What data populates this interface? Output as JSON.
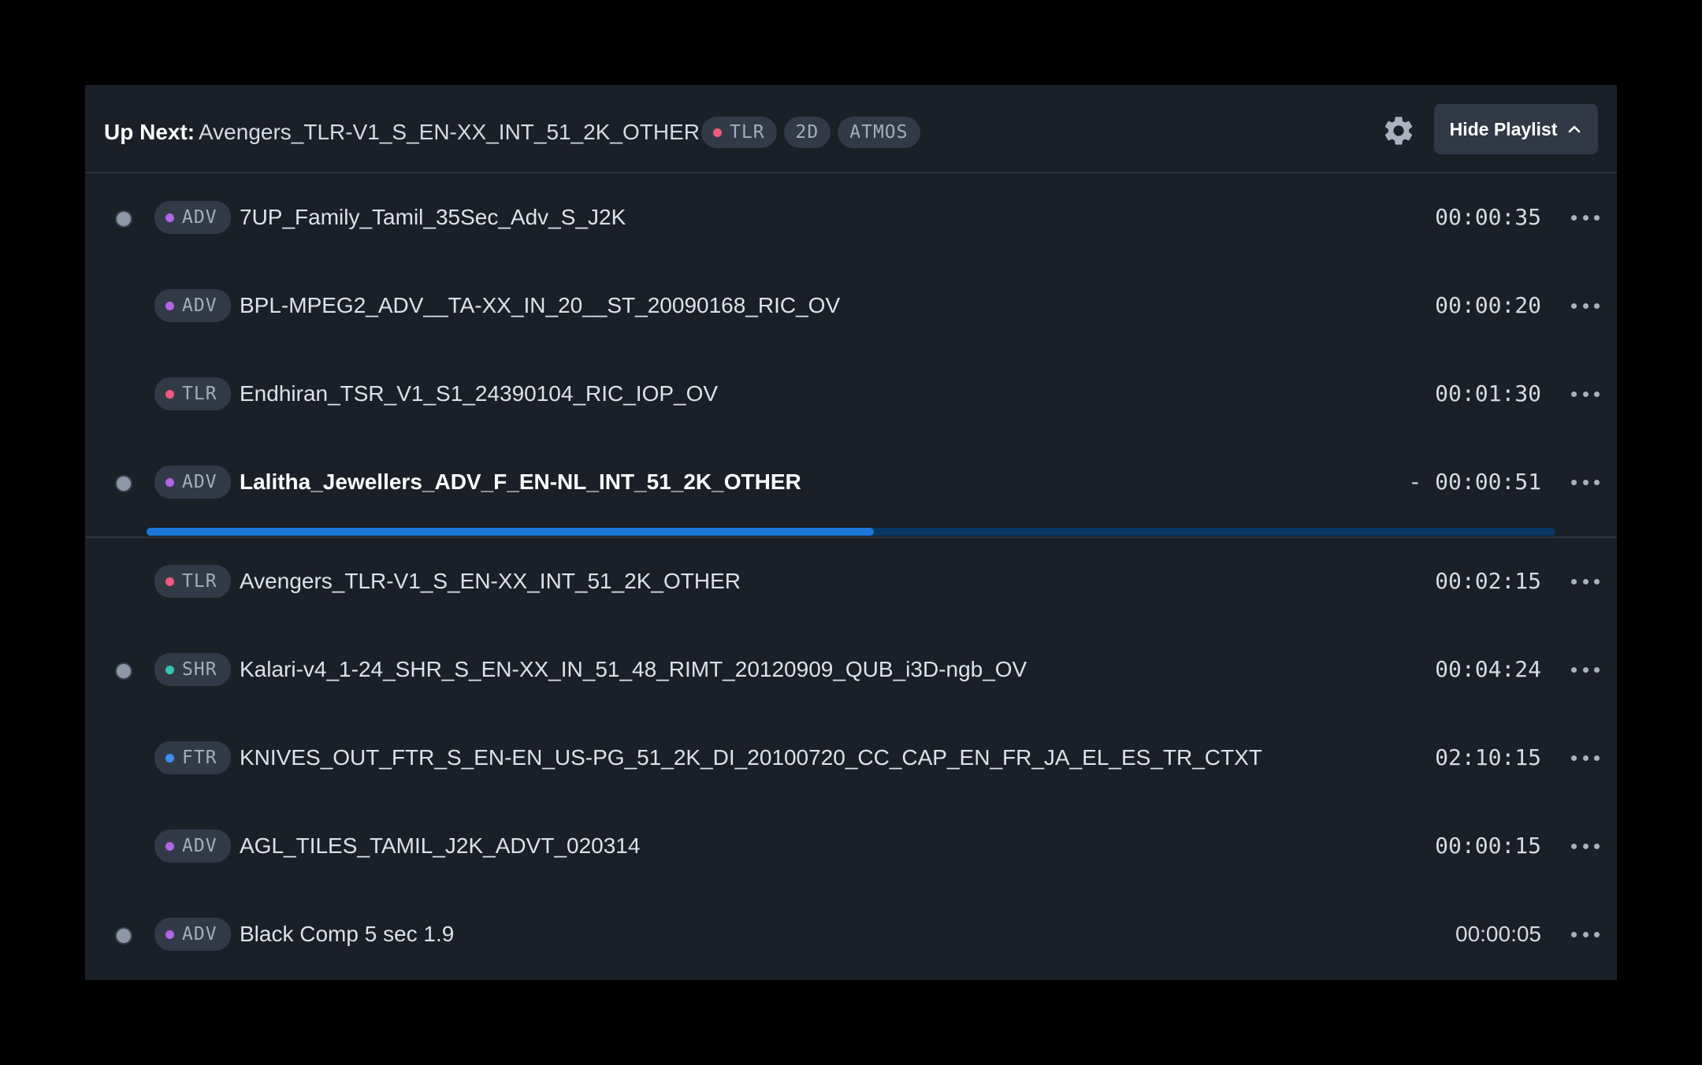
{
  "header": {
    "label": "Up Next:",
    "title": "Avengers_TLR-V1_S_EN-XX_INT_51_2K_OTHER",
    "badges": [
      {
        "text": "TLR",
        "dot_color": "#f15a80"
      },
      {
        "text": "2D"
      },
      {
        "text": "ATMOS"
      }
    ],
    "settings_icon": "gear-icon",
    "hide_button": {
      "label": "Hide Playlist",
      "icon": "chevron-up-icon"
    }
  },
  "colors": {
    "ADV": "#b264e6",
    "TLR": "#f15a80",
    "SHR": "#39c3b5",
    "FTR": "#3b8ff0",
    "progress_fill": "#1c78d8",
    "progress_track": "#0a3764"
  },
  "playlist": [
    {
      "type": "ADV",
      "name": "7UP_Family_Tamil_35Sec_Adv_S_J2K",
      "duration": "00:00:35",
      "marker": true
    },
    {
      "type": "ADV",
      "name": "BPL-MPEG2_ADV__TA-XX_IN_20__ST_20090168_RIC_OV",
      "duration": "00:00:20",
      "marker": false
    },
    {
      "type": "TLR",
      "name": "Endhiran_TSR_V1_S1_24390104_RIC_IOP_OV",
      "duration": "00:01:30",
      "marker": false
    },
    {
      "type": "ADV",
      "name": "Lalitha_Jewellers_ADV_F_EN-NL_INT_51_2K_OTHER",
      "duration": "- 00:00:51",
      "marker": true,
      "active": true
    },
    {
      "type": "TLR",
      "name": "Avengers_TLR-V1_S_EN-XX_INT_51_2K_OTHER",
      "duration": "00:02:15",
      "marker": false
    },
    {
      "type": "SHR",
      "name": "Kalari-v4_1-24_SHR_S_EN-XX_IN_51_48_RIMT_20120909_QUB_i3D-ngb_OV",
      "duration": "00:04:24",
      "marker": true
    },
    {
      "type": "FTR",
      "name": "KNIVES_OUT_FTR_S_EN-EN_US-PG_51_2K_DI_20100720_CC_CAP_EN_FR_JA_EL_ES_TR_CTXT",
      "duration": "02:10:15",
      "marker": false
    },
    {
      "type": "ADV",
      "name": "AGL_TILES_TAMIL_J2K_ADVT_020314",
      "duration": "00:00:15",
      "marker": false
    },
    {
      "type": "ADV",
      "name": "Black Comp 5 sec 1.9",
      "duration": "00:00:05",
      "marker": true,
      "plain_duration": true
    }
  ],
  "progress": {
    "fraction": 0.516
  },
  "more_icon": "more-horizontal-icon"
}
